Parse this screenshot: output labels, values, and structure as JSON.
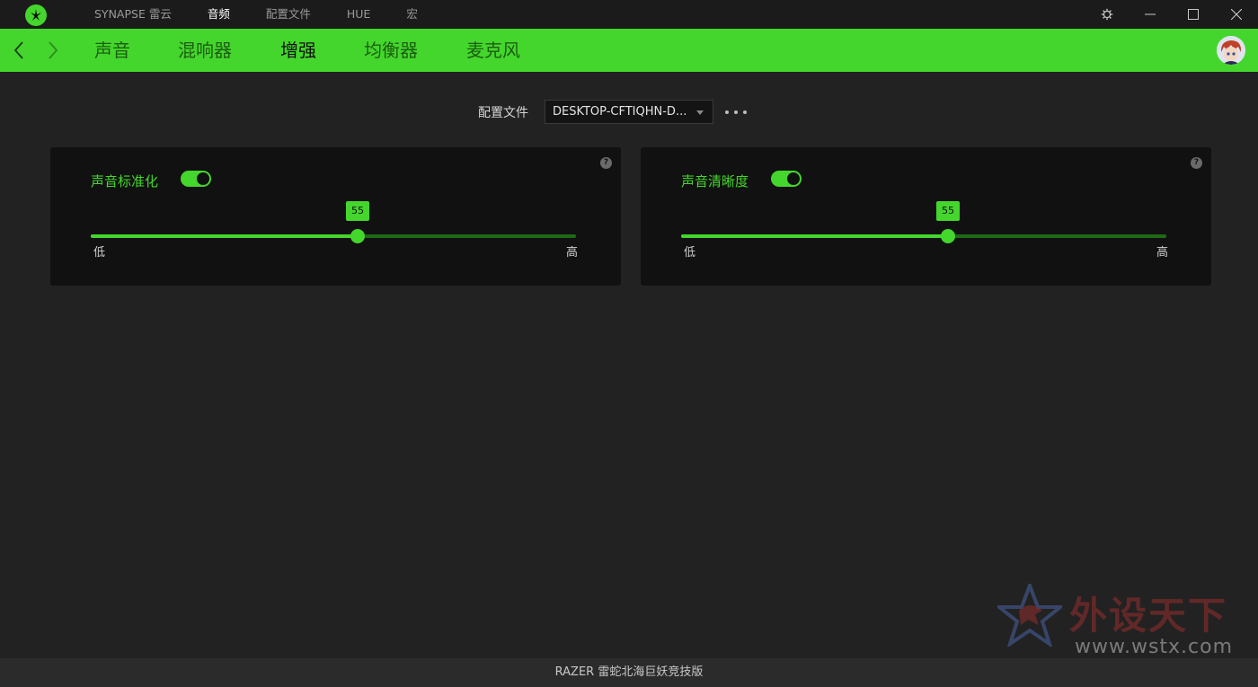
{
  "window": {
    "topnav": [
      {
        "label": "SYNAPSE 雷云",
        "active": false
      },
      {
        "label": "音频",
        "active": true
      },
      {
        "label": "配置文件",
        "active": false
      },
      {
        "label": "HUE",
        "active": false
      },
      {
        "label": "宏",
        "active": false
      }
    ],
    "icons": {
      "logo": "razer-logo-icon",
      "settings": "gear-icon",
      "minimize": "minimize-icon",
      "maximize": "maximize-icon",
      "close": "close-icon"
    }
  },
  "subnav": {
    "tabs": [
      {
        "label": "声音",
        "active": false
      },
      {
        "label": "混响器",
        "active": false
      },
      {
        "label": "增强",
        "active": true
      },
      {
        "label": "均衡器",
        "active": false
      },
      {
        "label": "麦克风",
        "active": false
      }
    ],
    "icons": {
      "back": "chevron-left-icon",
      "forward": "chevron-right-icon",
      "avatar": "user-avatar"
    }
  },
  "profile": {
    "label": "配置文件",
    "selected": "DESKTOP-CFTIQHN-D..."
  },
  "cards": [
    {
      "title": "声音标准化",
      "enabled": true,
      "value": 55,
      "value_label": "55",
      "min_label": "低",
      "max_label": "高",
      "help": "?"
    },
    {
      "title": "声音清晰度",
      "enabled": true,
      "value": 55,
      "value_label": "55",
      "min_label": "低",
      "max_label": "高",
      "help": "?"
    }
  ],
  "watermark": {
    "text": "外设天下",
    "url": "www.wstx.com"
  },
  "footer": {
    "device": "RAZER 雷蛇北海巨妖竞技版"
  },
  "colors": {
    "accent": "#44d62c",
    "background": "#222222",
    "card": "#111111",
    "titlebar": "#1b1b1b"
  }
}
